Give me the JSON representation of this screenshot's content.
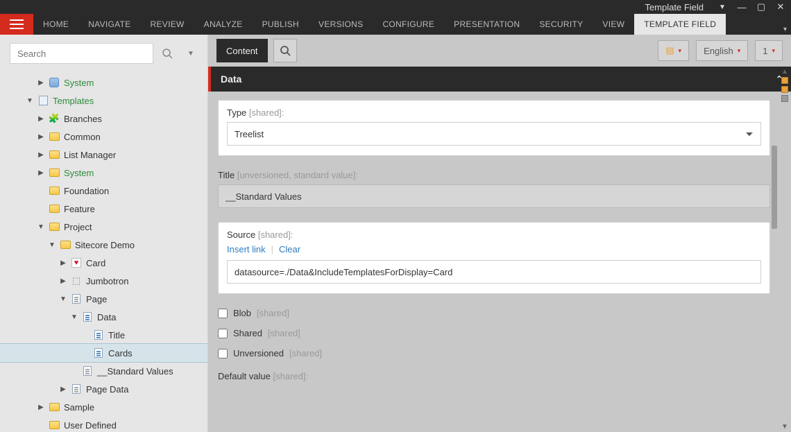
{
  "window": {
    "title": "Template Field"
  },
  "ribbon": {
    "tabs": [
      "HOME",
      "NAVIGATE",
      "REVIEW",
      "ANALYZE",
      "PUBLISH",
      "VERSIONS",
      "CONFIGURE",
      "PRESENTATION",
      "SECURITY",
      "VIEW",
      "TEMPLATE FIELD"
    ],
    "active": "TEMPLATE FIELD"
  },
  "search": {
    "placeholder": "Search"
  },
  "toolbar": {
    "content_tab": "Content",
    "language": "English",
    "version": "1"
  },
  "section": {
    "title": "Data"
  },
  "fields": {
    "type": {
      "label": "Type",
      "hint": "[shared]:",
      "value": "Treelist"
    },
    "title": {
      "label": "Title",
      "hint": "[unversioned, standard value]:",
      "value": "__Standard Values"
    },
    "source": {
      "label": "Source",
      "hint": "[shared]:",
      "insert_link": "Insert link",
      "clear": "Clear",
      "value": "datasource=./Data&IncludeTemplatesForDisplay=Card"
    },
    "blob": {
      "label": "Blob",
      "hint": "[shared]"
    },
    "shared": {
      "label": "Shared",
      "hint": "[shared]"
    },
    "unversioned": {
      "label": "Unversioned",
      "hint": "[shared]"
    },
    "default_value": {
      "label": "Default value",
      "hint": "[shared]:"
    }
  },
  "tree": [
    {
      "indent": 2,
      "toggle": "▶",
      "icon": "db",
      "label": "System",
      "green": true
    },
    {
      "indent": 1,
      "toggle": "▼",
      "icon": "tmpl",
      "label": "Templates",
      "green": true
    },
    {
      "indent": 2,
      "toggle": "▶",
      "icon": "puzzle",
      "label": "Branches"
    },
    {
      "indent": 2,
      "toggle": "▶",
      "icon": "folder",
      "label": "Common"
    },
    {
      "indent": 2,
      "toggle": "▶",
      "icon": "folder",
      "label": "List Manager"
    },
    {
      "indent": 2,
      "toggle": "▶",
      "icon": "folder",
      "label": "System",
      "green": true
    },
    {
      "indent": 2,
      "toggle": "",
      "icon": "folder",
      "label": "Foundation"
    },
    {
      "indent": 2,
      "toggle": "",
      "icon": "folder",
      "label": "Feature"
    },
    {
      "indent": 2,
      "toggle": "▼",
      "icon": "folder",
      "label": "Project"
    },
    {
      "indent": 3,
      "toggle": "▼",
      "icon": "folder",
      "label": "Sitecore Demo"
    },
    {
      "indent": 4,
      "toggle": "▶",
      "icon": "heart",
      "label": "Card"
    },
    {
      "indent": 4,
      "toggle": "▶",
      "icon": "cube",
      "label": "Jumbotron"
    },
    {
      "indent": 4,
      "toggle": "▼",
      "icon": "docgray",
      "label": "Page"
    },
    {
      "indent": 5,
      "toggle": "▼",
      "icon": "docblue",
      "label": "Data"
    },
    {
      "indent": 6,
      "toggle": "",
      "icon": "docblue",
      "label": "Title"
    },
    {
      "indent": 6,
      "toggle": "",
      "icon": "docblue",
      "label": "Cards",
      "selected": true
    },
    {
      "indent": 5,
      "toggle": "",
      "icon": "docgray",
      "label": "__Standard Values"
    },
    {
      "indent": 4,
      "toggle": "▶",
      "icon": "docgray",
      "label": "Page Data"
    },
    {
      "indent": 2,
      "toggle": "▶",
      "icon": "folder",
      "label": "Sample"
    },
    {
      "indent": 2,
      "toggle": "",
      "icon": "folder",
      "label": "User Defined"
    }
  ]
}
